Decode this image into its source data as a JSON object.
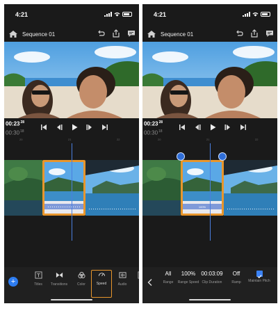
{
  "left": {
    "status": {
      "time": "4:21"
    },
    "nav": {
      "title": "Sequence 01"
    },
    "timecode": {
      "current": "00:23",
      "current_frames": "28",
      "duration": "00:30",
      "duration_frames": "18"
    },
    "ruler": [
      "20",
      "21",
      "22"
    ],
    "toolbar": {
      "items": [
        {
          "label": "Titles",
          "icon": "titles-icon"
        },
        {
          "label": "Transitions",
          "icon": "transitions-icon"
        },
        {
          "label": "Color",
          "icon": "color-icon"
        },
        {
          "label": "Speed",
          "icon": "speed-icon",
          "active": true
        },
        {
          "label": "Audio",
          "icon": "audio-icon"
        },
        {
          "label": "Ti",
          "icon": "text-icon"
        }
      ]
    }
  },
  "right": {
    "status": {
      "time": "4:21"
    },
    "nav": {
      "title": "Sequence 01"
    },
    "timecode": {
      "current": "00:23",
      "current_frames": "28",
      "duration": "00:30",
      "duration_frames": "18"
    },
    "ruler": [
      "20",
      "21",
      "22"
    ],
    "clip_speed_label": "100%",
    "speed_panel": {
      "items": [
        {
          "value": "All",
          "label": "Range"
        },
        {
          "value": "100%",
          "label": "Range Speed"
        },
        {
          "value": "00:03:09",
          "label": "Clip Duration"
        },
        {
          "value": "Off",
          "label": "Ramp"
        },
        {
          "value": "",
          "label": "Maintain Pitch",
          "checked": true
        }
      ]
    }
  },
  "colors": {
    "accent": "#2d7cf0",
    "selection": "#e8962c",
    "background": "#1a1a1a"
  }
}
